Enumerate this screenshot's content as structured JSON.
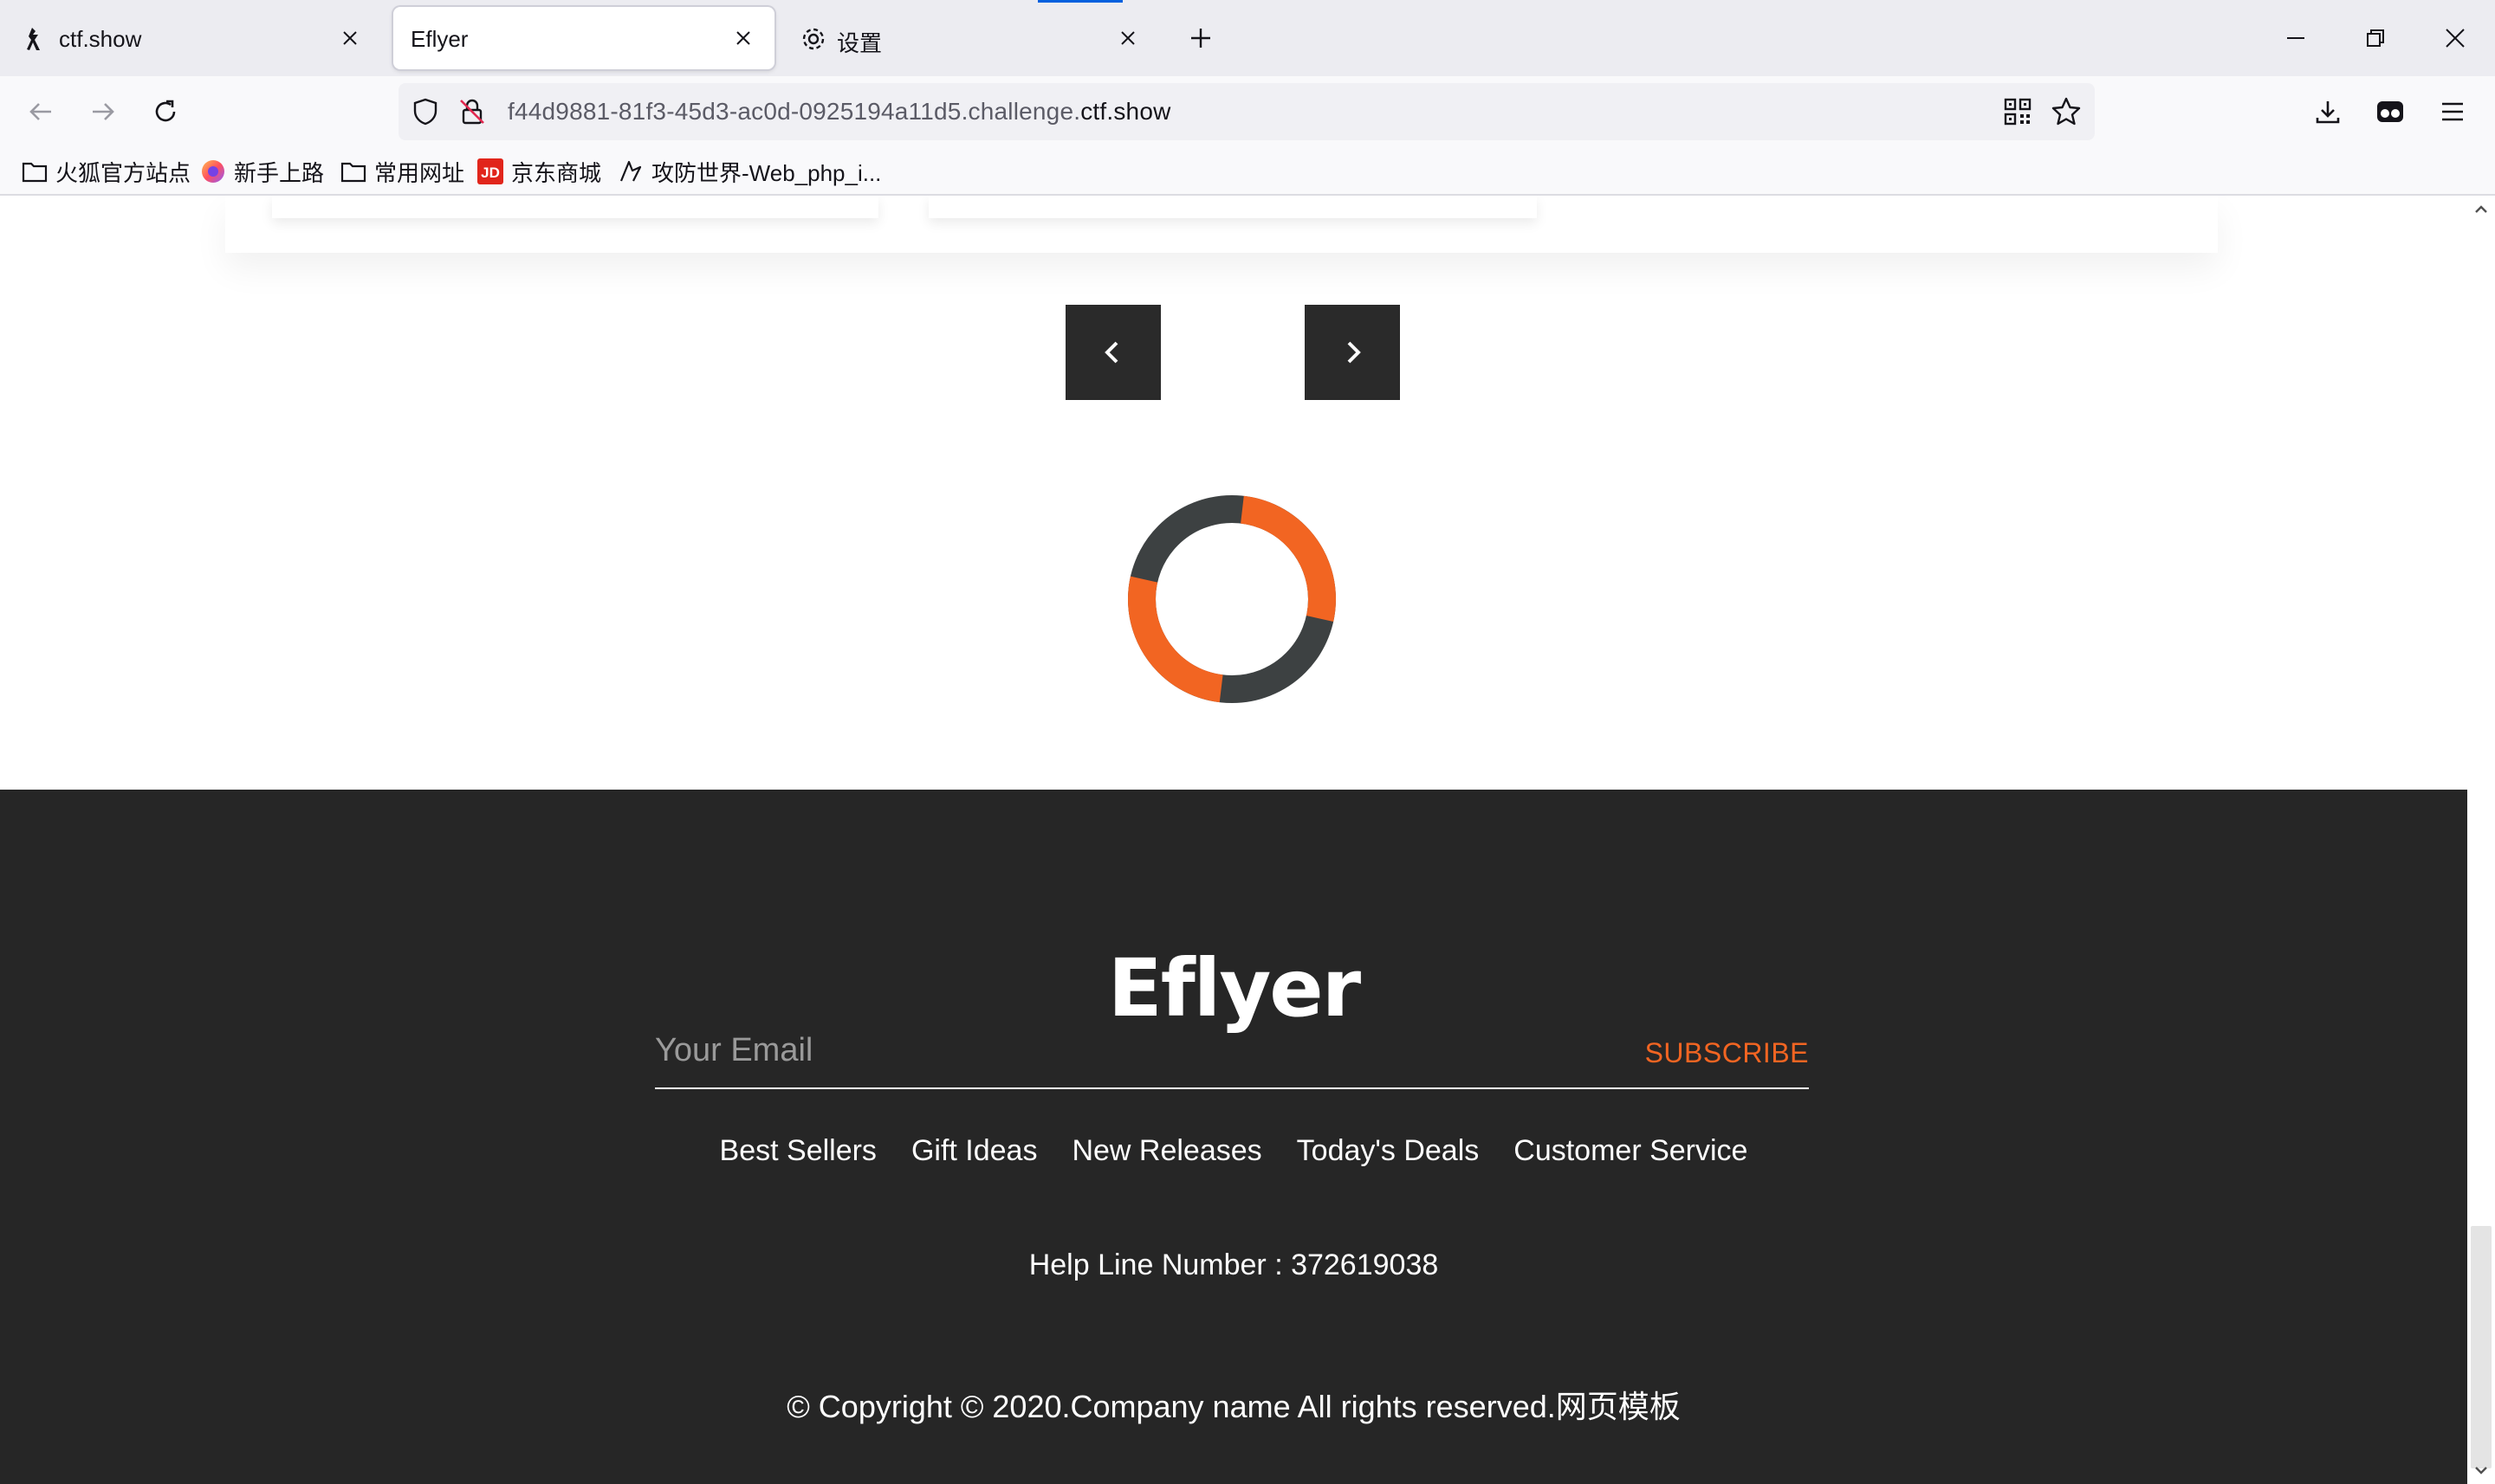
{
  "browser": {
    "tabs": [
      {
        "title": "ctf.show",
        "icon": "ctfshow-icon",
        "active": false
      },
      {
        "title": "Eflyer",
        "icon": "none",
        "active": true
      },
      {
        "title": "设置",
        "icon": "gear-icon",
        "active": false
      }
    ],
    "url_path": "f44d9881-81f3-45d3-ac0d-0925194a11d5.challenge.",
    "url_domain": "ctf.show",
    "bookmarks": [
      {
        "label": "火狐官方站点",
        "icon": "folder-icon"
      },
      {
        "label": "新手上路",
        "icon": "firefox-icon"
      },
      {
        "label": "常用网址",
        "icon": "folder-icon"
      },
      {
        "label": "京东商城",
        "icon": "jd-icon"
      },
      {
        "label": "攻防世界-Web_php_i...",
        "icon": "adworld-icon"
      }
    ]
  },
  "page": {
    "prev_label": "‹",
    "next_label": "›",
    "accent_color": "#f26522",
    "dark_color": "#2a2a2a",
    "footer": {
      "logo": "Eflyer",
      "email_placeholder": "Your Email",
      "subscribe_label": "SUBSCRIBE",
      "nav": [
        "Best Sellers",
        "Gift Ideas",
        "New Releases",
        "Today's Deals",
        "Customer Service"
      ],
      "helpline": "Help Line Number : 372619038",
      "copyright": "© Copyright © 2020.Company name All rights reserved.网页模板"
    }
  }
}
